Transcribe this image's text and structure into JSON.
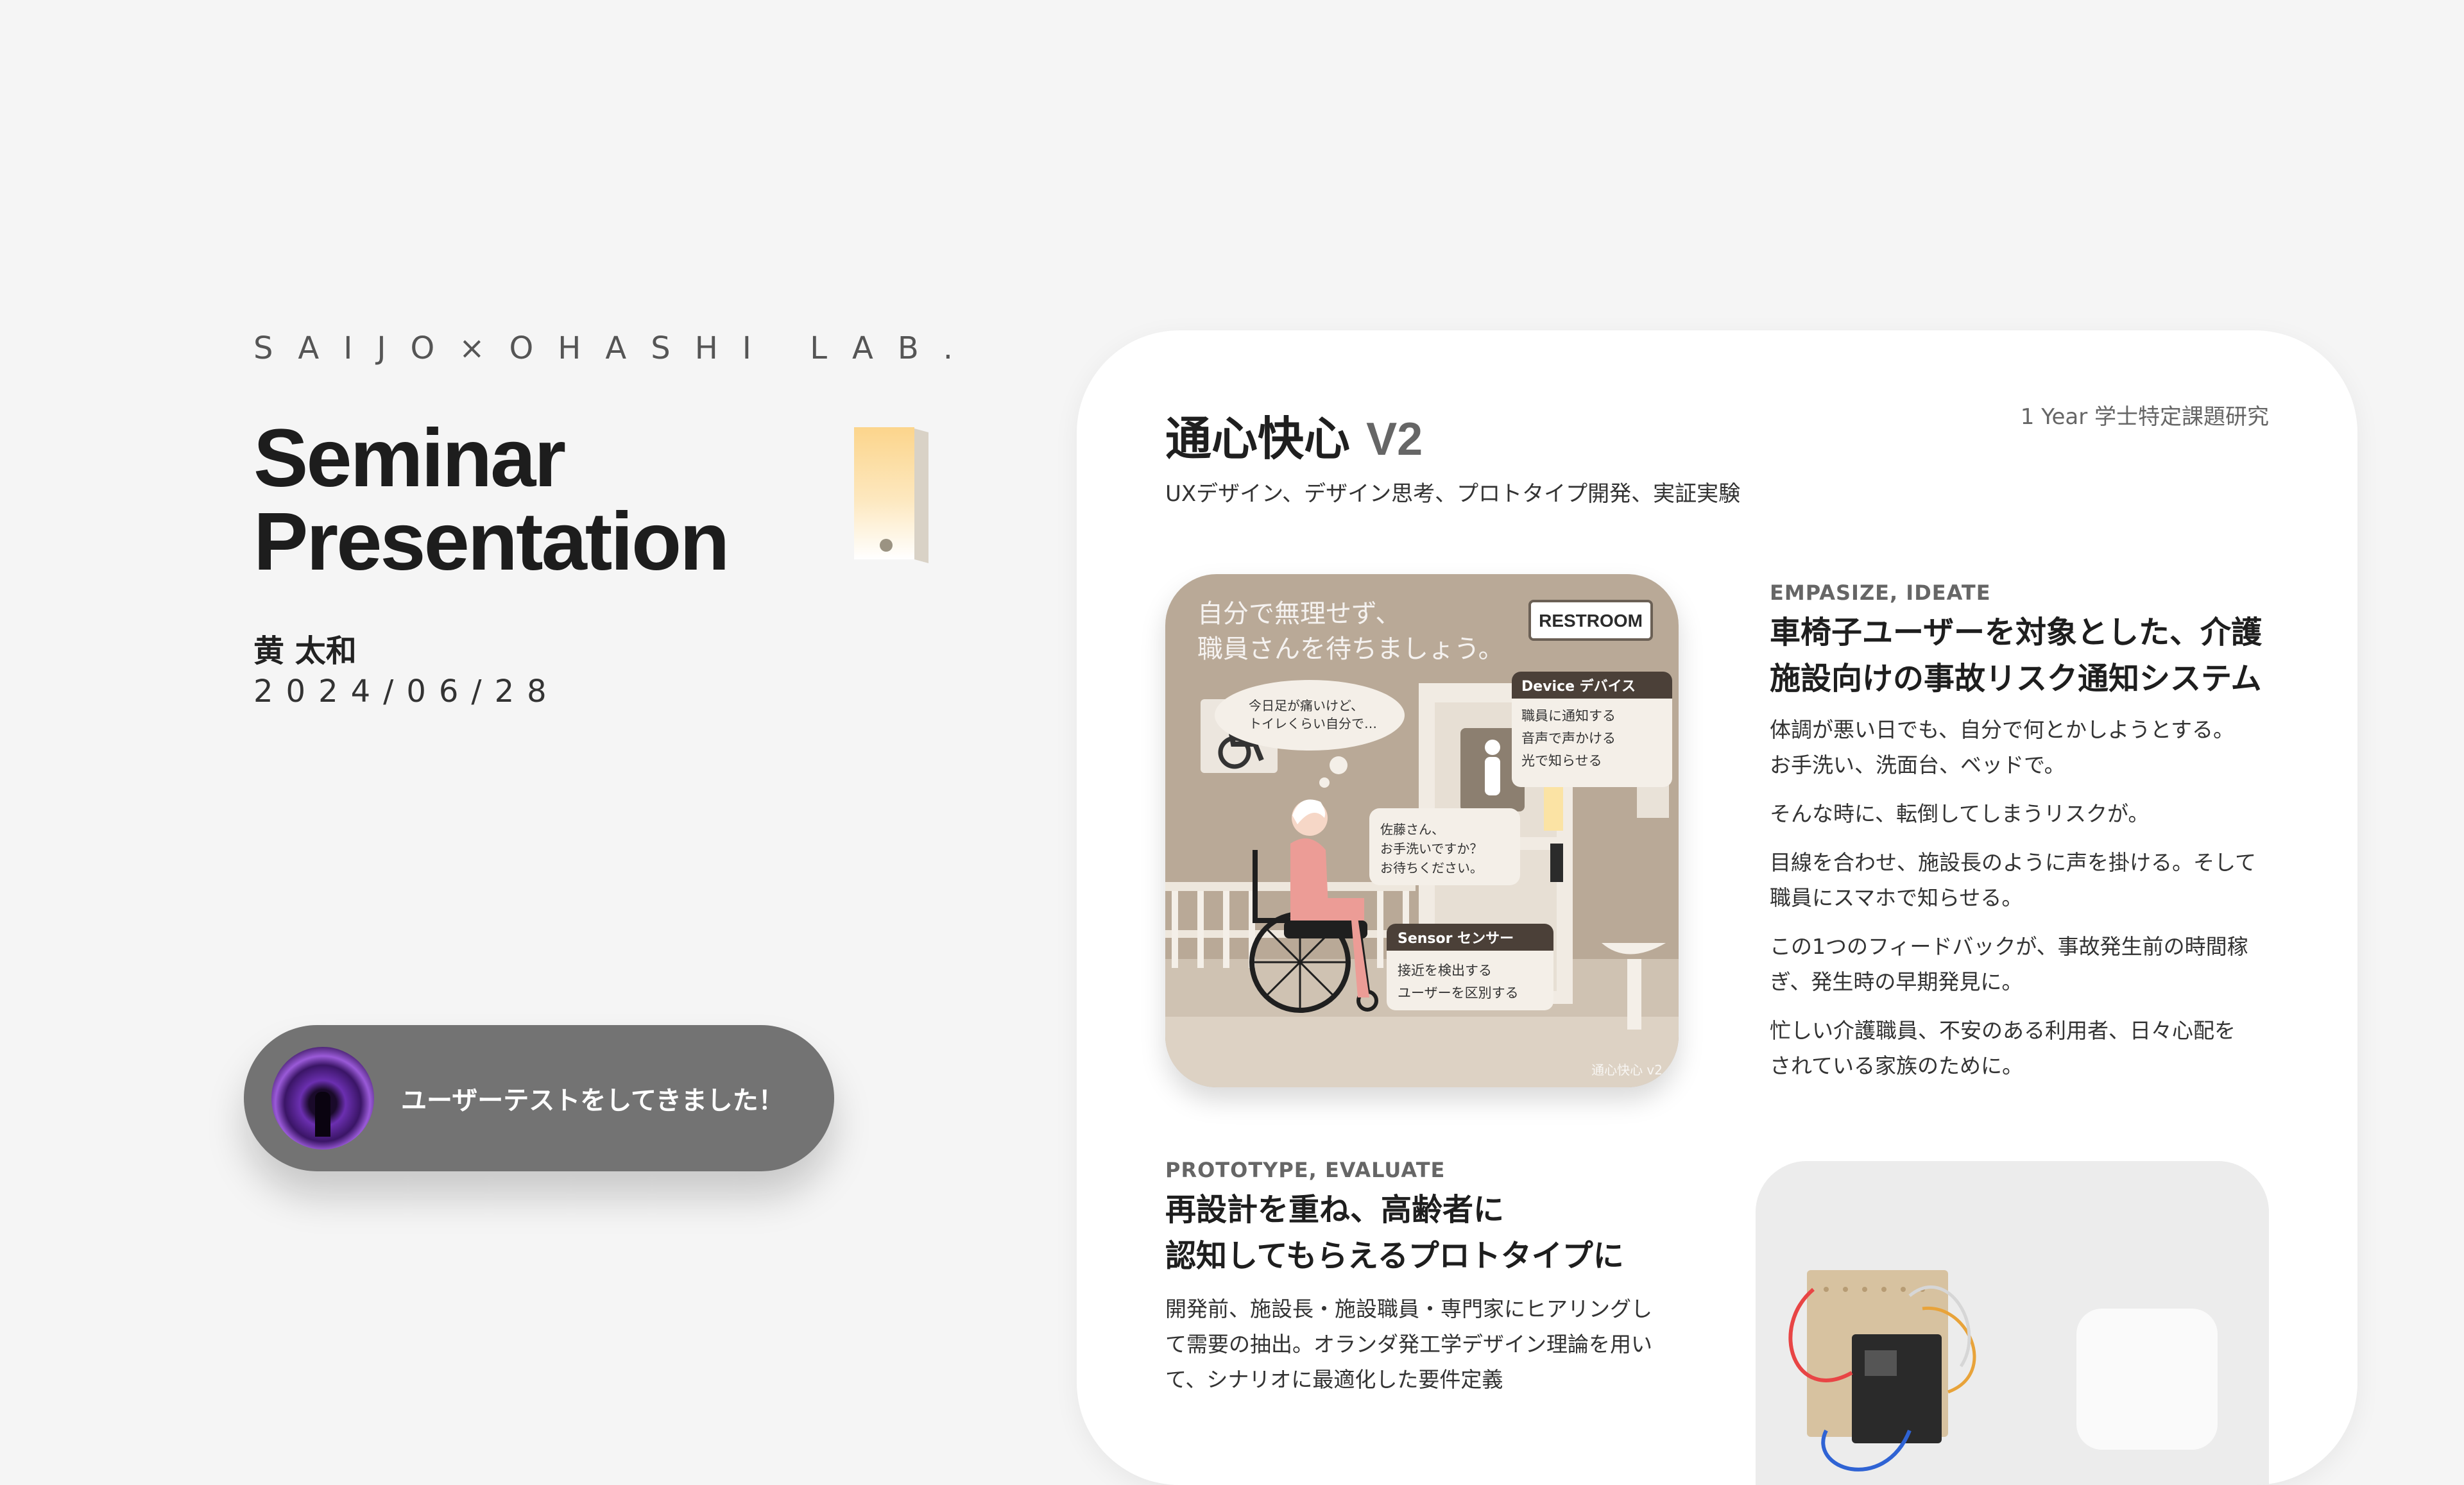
{
  "lab": "SAIJO×OHASHI LAB.",
  "title": {
    "line1": "Seminar",
    "line2": "Presentation"
  },
  "author": "黄 太和",
  "date": "2024/06/28",
  "toast": {
    "message": "ユーザーテストをしてきました！"
  },
  "project": {
    "name": "通心快心",
    "version": "V2",
    "meta": "1 Year  学士特定課題研究",
    "tags": "UXデザイン、デザイン思考、プロトタイプ開発、実証実験"
  },
  "illustration": {
    "headline_line1": "自分で無理せず、",
    "headline_line2": "職員さんを待ちましょう。",
    "restroom": "RESTROOM",
    "thought_line1": "今日足が痛いけど、",
    "thought_line2": "トイレくらい自分で…",
    "device_title": "Device デバイス",
    "device_items": [
      "職員に通知する",
      "音声で声かける",
      "光で知らせる"
    ],
    "speech_line1": "佐藤さん、",
    "speech_line2": "お手洗いですか？",
    "speech_line3": "お待ちください。",
    "sensor_title": "Sensor センサー",
    "sensor_items": [
      "接近を検出する",
      "ユーザーを区別する"
    ],
    "watermark": "通心快心 v2"
  },
  "section1": {
    "label": "EMPASIZE, IDEATE",
    "heading_line1": "車椅子ユーザーを対象とした、介護",
    "heading_line2": "施設向けの事故リスク通知システム",
    "paragraphs": [
      {
        "l1": "体調が悪い日でも、自分で何とかしようとする。",
        "l2": "お手洗い、洗面台、ベッドで。"
      },
      {
        "l1": "そんな時に、転倒してしまうリスクが。",
        "l2": ""
      },
      {
        "l1": "目線を合わせ、施設長のように声を掛ける。そして",
        "l2": "職員にスマホで知らせる。"
      },
      {
        "l1": "この1つのフィードバックが、事故発生前の時間稼",
        "l2": "ぎ、発生時の早期発見に。"
      },
      {
        "l1": "忙しい介護職員、不安のある利用者、日々心配を",
        "l2": "されている家族のために。"
      }
    ]
  },
  "section2": {
    "label": "PROTOTYPE, EVALUATE",
    "heading_line1": "再設計を重ね、高齢者に",
    "heading_line2": "認知してもらえるプロトタイプに",
    "body_line1": "開発前、施設長・施設職員・専門家にヒアリングし",
    "body_line2": "て需要の抽出。オランダ発工学デザイン理論を用い",
    "body_line3": "て、シナリオに最適化した要件定義"
  },
  "colors": {
    "background": "#f5f5f5",
    "card": "#ffffff",
    "toast": "#737373",
    "illustration_bg": "#b9a997"
  }
}
